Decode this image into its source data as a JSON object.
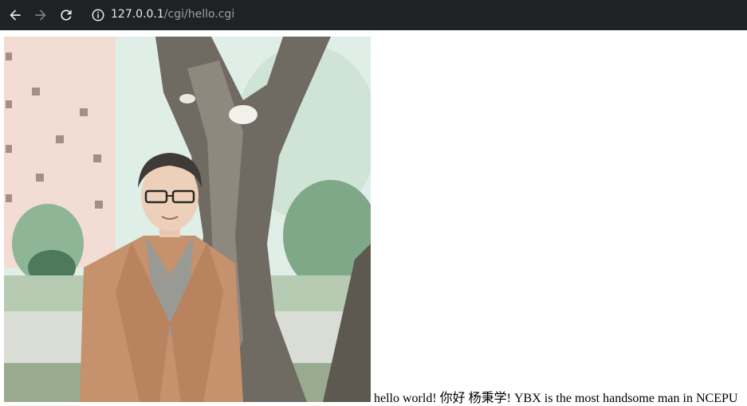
{
  "browser": {
    "url_host": "127.0.0.1",
    "url_path": "/cgi/hello.cgi",
    "icons": [
      "back-arrow-icon",
      "forward-arrow-icon",
      "reload-icon",
      "info-icon"
    ]
  },
  "page": {
    "greeting": "hello world! 你好 杨秉学! YBX is the most handsome man in NCEPU"
  },
  "colors": {
    "toolbar_bg": "#202124",
    "url_text": "#e8eaed",
    "url_path": "#9aa0a6"
  }
}
